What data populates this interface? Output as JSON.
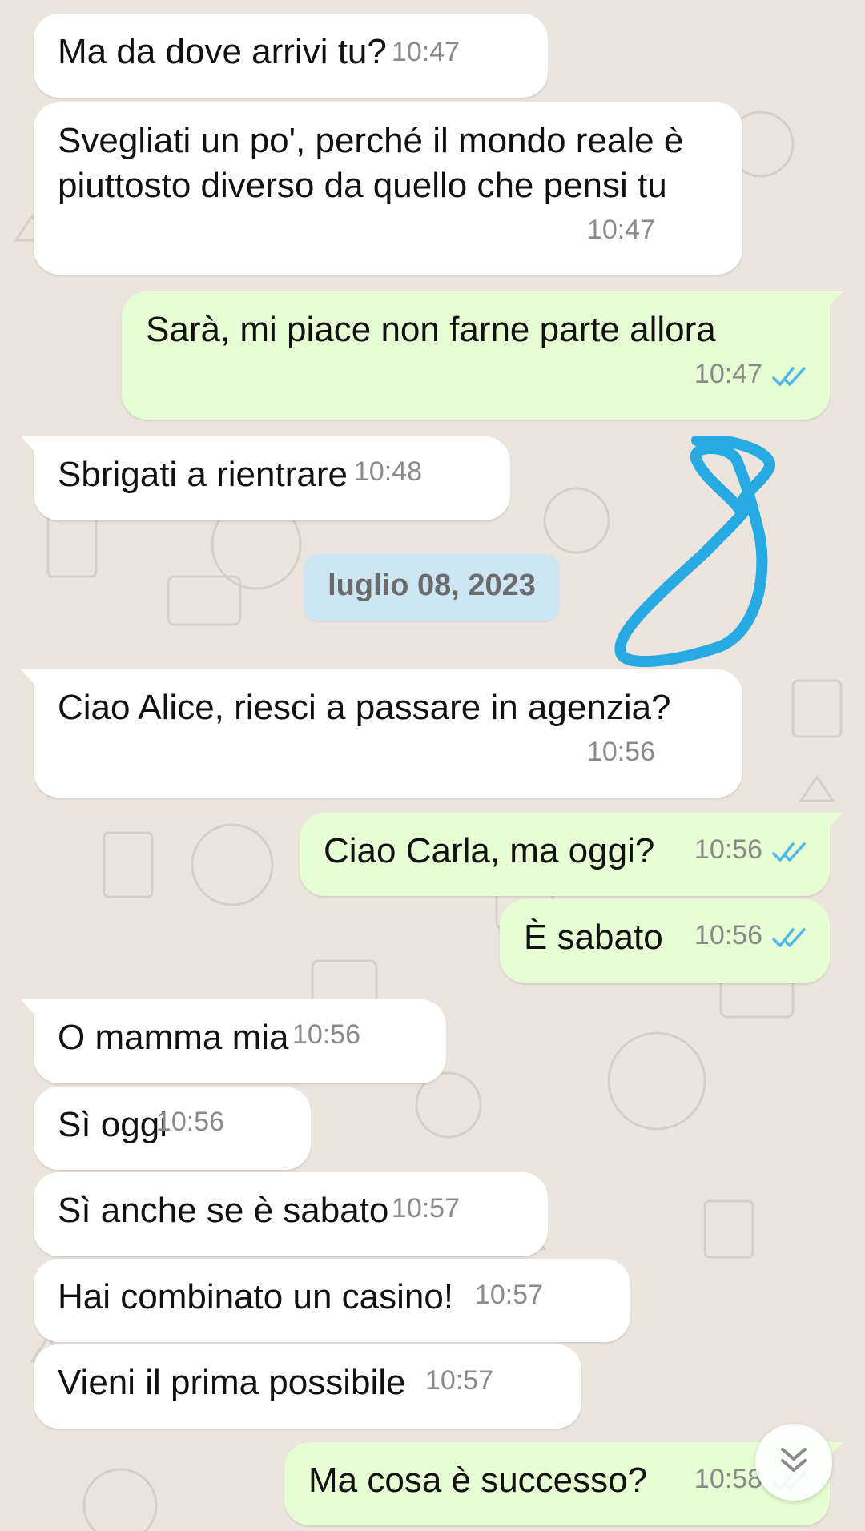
{
  "theme": {
    "incoming_bubble": "#ffffff",
    "outgoing_bubble": "#e7fdd3",
    "read_ticks": "#4fb6ec",
    "date_chip": "#cde6f3",
    "scribble": "#27a9e1"
  },
  "messages": [
    {
      "direction": "in",
      "text": "Ma da dove arrivi tu?",
      "time": "10:47"
    },
    {
      "direction": "in",
      "text": "Svegliati un po', perché il mondo reale è\npiuttosto diverso da quello che pensi tu",
      "time": "10:47"
    },
    {
      "direction": "out",
      "text": "Sarà, mi piace non farne parte allora",
      "time": "10:47",
      "status": "read"
    },
    {
      "direction": "in",
      "text": "Sbrigati a rientrare",
      "time": "10:48"
    },
    {
      "direction": "in",
      "text": "Ciao Alice, riesci a passare in agenzia?",
      "time": "10:56"
    },
    {
      "direction": "out",
      "text": "Ciao Carla, ma oggi?",
      "time": "10:56",
      "status": "read"
    },
    {
      "direction": "out",
      "text": "È sabato",
      "time": "10:56",
      "status": "read"
    },
    {
      "direction": "in",
      "text": "O mamma mia",
      "time": "10:56"
    },
    {
      "direction": "in",
      "text": "Sì oggi",
      "time": "10:56"
    },
    {
      "direction": "in",
      "text": "Sì anche se è sabato",
      "time": "10:57"
    },
    {
      "direction": "in",
      "text": "Hai combinato un casino!",
      "time": "10:57"
    },
    {
      "direction": "in",
      "text": "Vieni il prima possibile",
      "time": "10:57"
    },
    {
      "direction": "out",
      "text": "Ma cosa è successo?",
      "time": "10:58",
      "status": "read"
    }
  ],
  "date_separator": {
    "label": "luglio 08, 2023"
  },
  "icons": {
    "scroll_down": "double-chevron-down-icon",
    "read_ticks": "double-check-icon"
  }
}
